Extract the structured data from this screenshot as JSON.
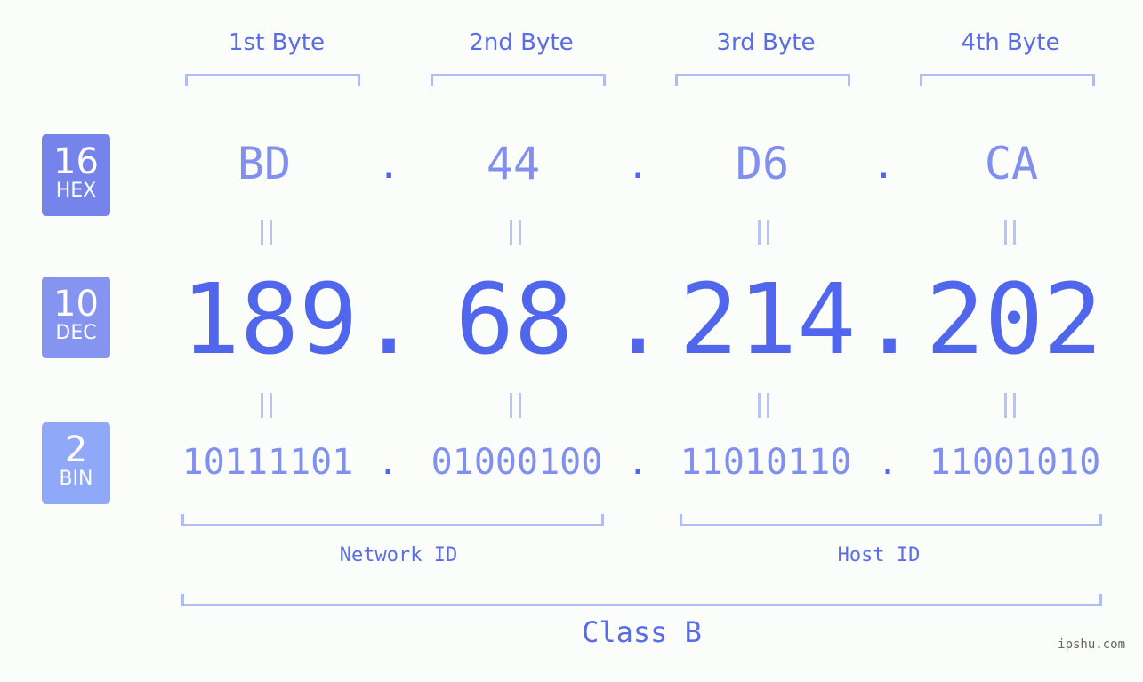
{
  "bytes": [
    {
      "label": "1st Byte",
      "hex": "BD",
      "dec": "189",
      "bin": "10111101"
    },
    {
      "label": "2nd Byte",
      "hex": "44",
      "dec": "68",
      "bin": "01000100"
    },
    {
      "label": "3rd Byte",
      "hex": "D6",
      "dec": "214",
      "bin": "11010110"
    },
    {
      "label": "4th Byte",
      "hex": "CA",
      "dec": "202",
      "bin": "11001010"
    }
  ],
  "separator": ".",
  "badges": {
    "hex": {
      "num": "16",
      "label": "HEX",
      "color": "#7584ea"
    },
    "dec": {
      "num": "10",
      "label": "DEC",
      "color": "#8494f0"
    },
    "bin": {
      "num": "2",
      "label": "BIN",
      "color": "#8fa8f8"
    }
  },
  "segments": {
    "network": "Network ID",
    "host": "Host ID",
    "class": "Class B"
  },
  "watermark": "ipshu.com",
  "colors": {
    "accent": "#5066ec",
    "light": "#8190ee",
    "bracket": "#b1bcf5"
  }
}
